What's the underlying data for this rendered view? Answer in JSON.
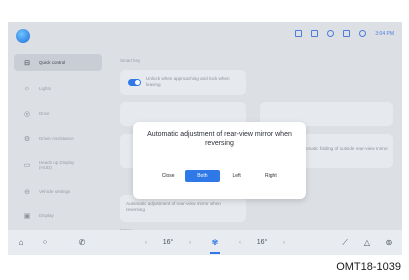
{
  "sidebar": {
    "items": [
      {
        "label": "Quick control",
        "icon": "car-icon",
        "glyph": "⊟",
        "active": true
      },
      {
        "label": "Lights",
        "icon": "light-icon",
        "glyph": "☼",
        "active": false
      },
      {
        "label": "Drive",
        "icon": "steering-wheel-icon",
        "glyph": "◎",
        "active": false
      },
      {
        "label": "Driver Assistance",
        "icon": "driver-assist-icon",
        "glyph": "⚙",
        "active": false
      },
      {
        "label": "Heads up Display (HUD)",
        "icon": "hud-icon",
        "glyph": "▭",
        "active": false
      },
      {
        "label": "Vehicle settings",
        "icon": "vehicle-settings-icon",
        "glyph": "⊖",
        "active": false
      },
      {
        "label": "Display",
        "icon": "display-icon",
        "glyph": "▣",
        "active": false
      }
    ]
  },
  "main": {
    "smart_key_title": "Smart key",
    "unlock_text": "Unlock when approaching and lock when leaving",
    "fold_text": "Automatic folding of outside rear-view mirror",
    "adjust_text": "Automatic adjustment of rear-view mirror when reversing",
    "mirror_title": "Mirror"
  },
  "dialog": {
    "title": "Automatic adjustment of rear-view mirror when reversing",
    "options": [
      "Close",
      "Both",
      "Left",
      "Right"
    ],
    "selected": "Both"
  },
  "dock": {
    "left_temp": "16°",
    "right_temp": "16°",
    "left_arrow": "‹",
    "right_arrow": "›"
  },
  "status": {
    "clock": "3:04 PM"
  },
  "caption": "OMT18-1039",
  "colors": {
    "accent": "#2f78e8",
    "screen_bg": "#dcdfe4",
    "dialog_bg": "#ffffff"
  }
}
